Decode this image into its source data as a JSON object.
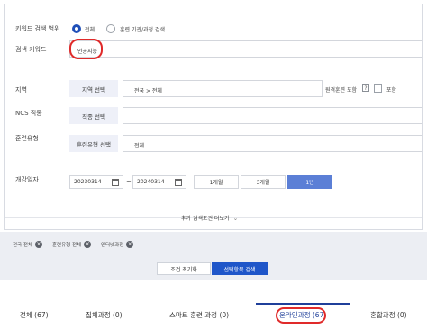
{
  "search": {
    "scope_label": "키워드 검색 범위",
    "scope_options": [
      "전체",
      "훈련 기관/과정 검색"
    ],
    "keyword_label": "검색 키워드",
    "keyword_value": "인공지능",
    "region_label": "지역",
    "region_button": "지역 선택",
    "region_value": "전국 > 전체",
    "remote_label": "원격훈련 포함",
    "remote_help": "?",
    "remote_checkbox_label": "포함",
    "ncs_label": "NCS 직종",
    "ncs_button": "직종 선택",
    "training_type_label": "훈련유형",
    "training_type_button": "훈련유형 선택",
    "training_type_value": "전체",
    "date_label": "개강일자",
    "date_from": "20230314",
    "date_separator": "~",
    "date_to": "20240314",
    "periods": [
      "1개월",
      "3개월",
      "1년"
    ],
    "more_conditions": "추가 검색조건 더보기"
  },
  "filters": {
    "chips": [
      "전국 전체",
      "훈련유형 전체",
      "인터넷과정"
    ],
    "reset_label": "조건 초기화",
    "search_label": "선택항목 검색"
  },
  "tabs": [
    "전체 (67)",
    "집체과정 (0)",
    "스마트 훈련 과정 (0)",
    "온라인과정 (67)",
    "혼합과정 (0)"
  ],
  "colors": {
    "accent": "#1f4fb8",
    "period_active": "#5b7fd6",
    "search_button": "#1f56c9",
    "highlight": "#e02a2a",
    "button_bg": "#eef0f8"
  }
}
